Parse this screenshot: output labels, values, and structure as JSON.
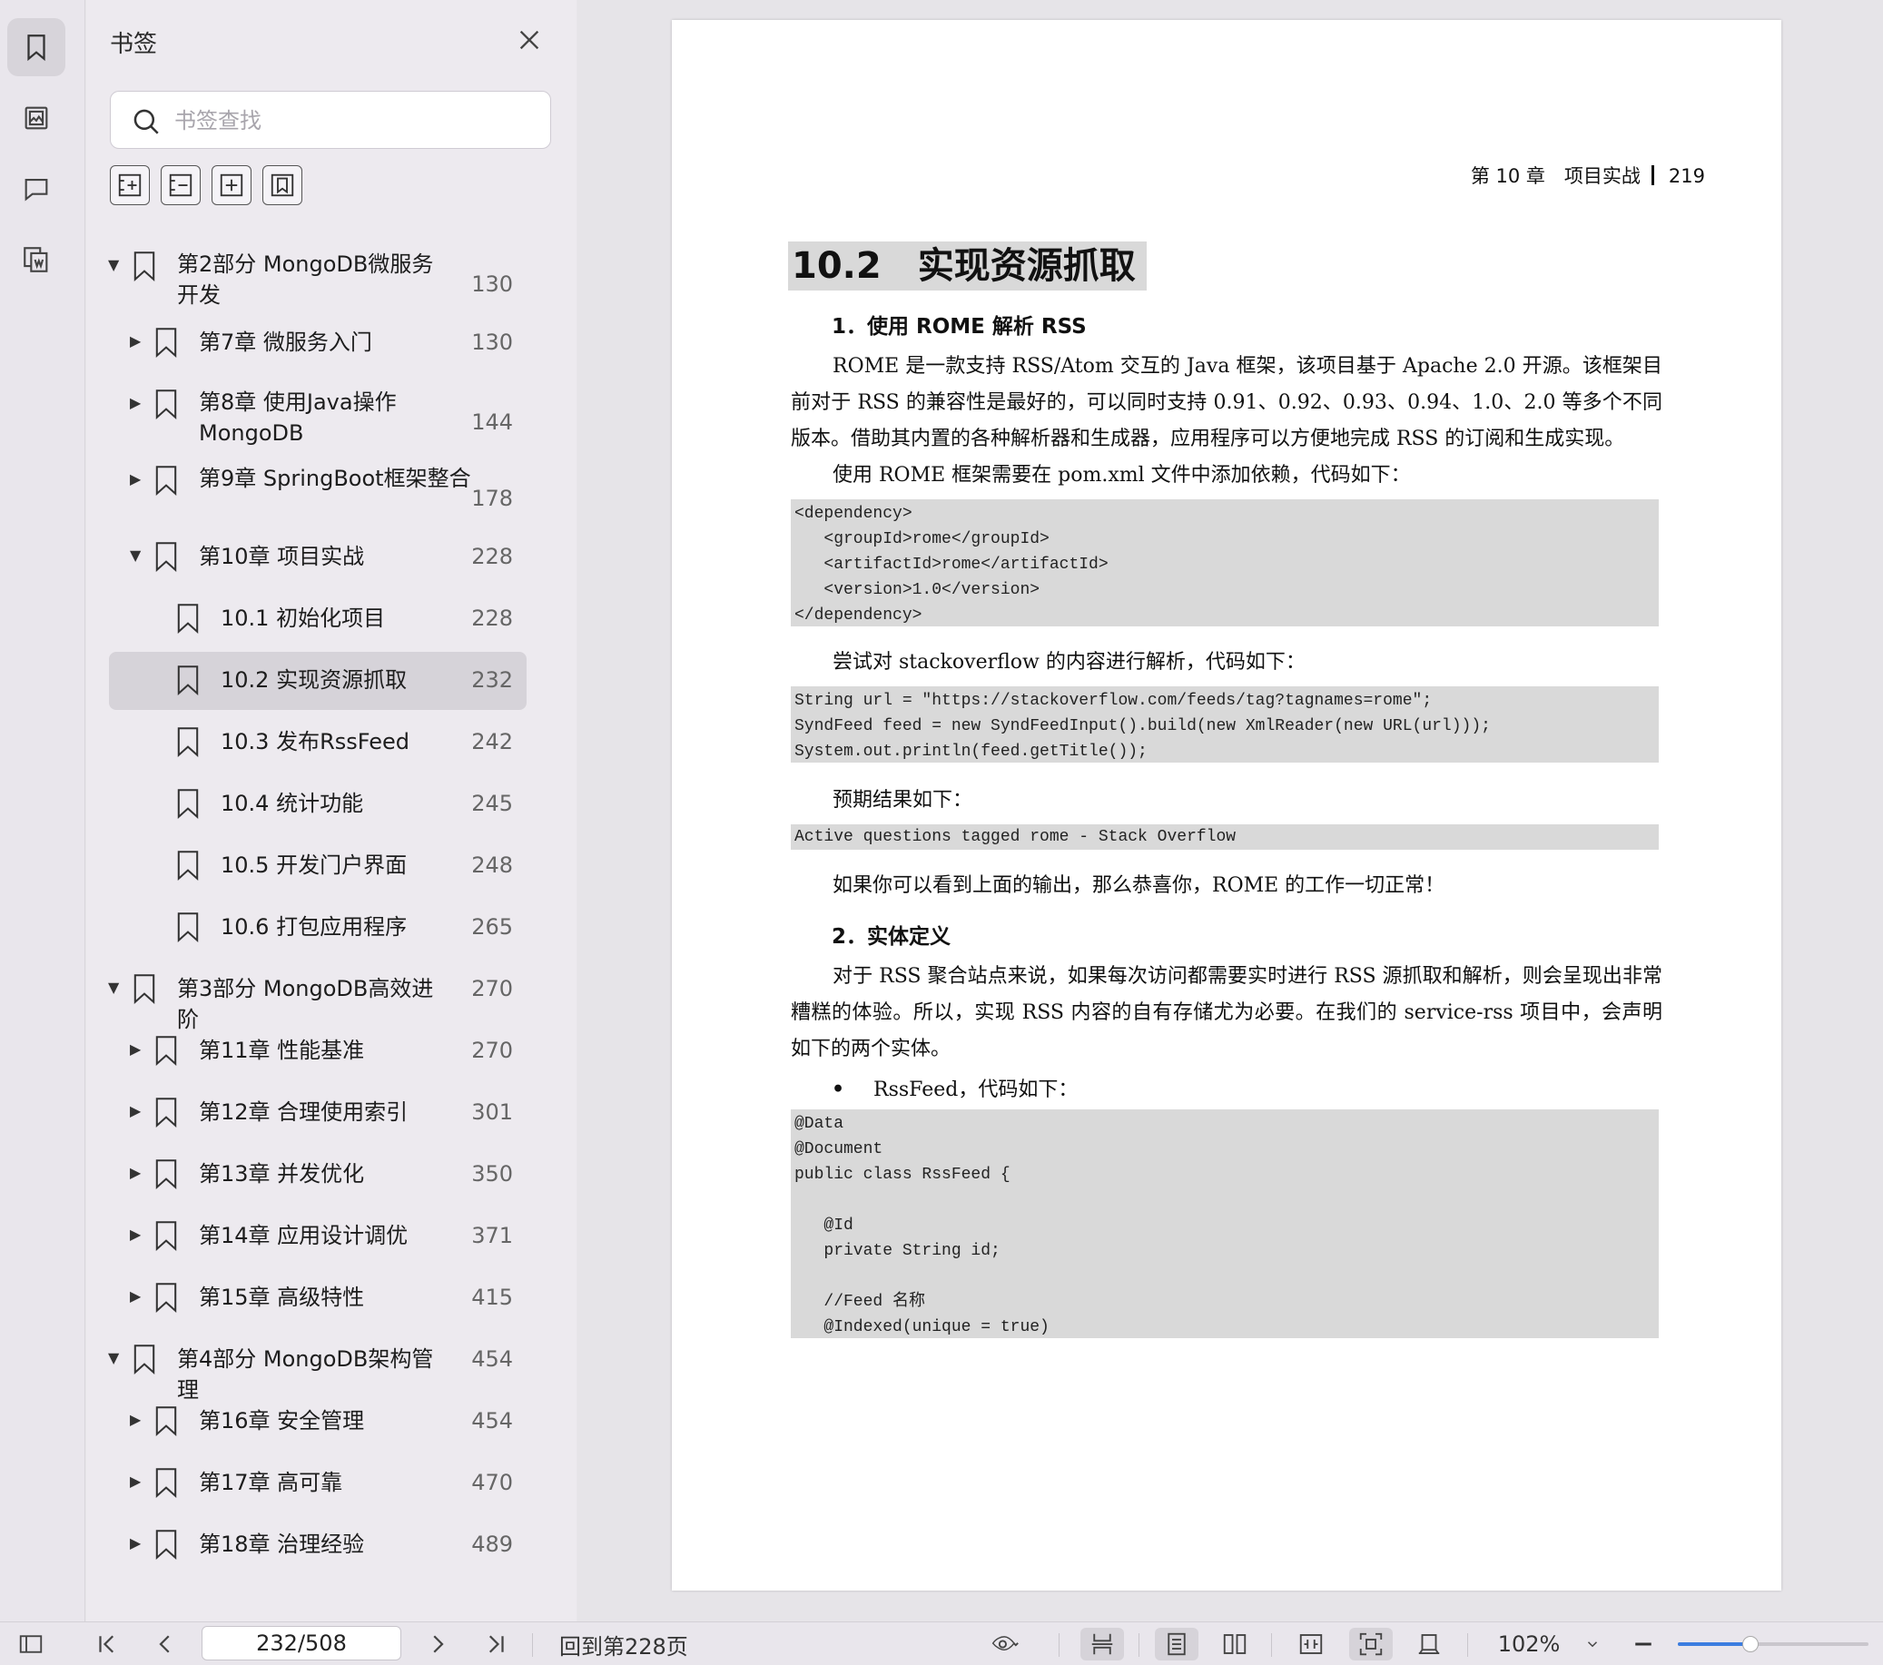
{
  "panel": {
    "title": "书签",
    "search_placeholder": "书签查找"
  },
  "bookmarks": [
    {
      "label": "第2部分 MongoDB微服务开发",
      "page": "130",
      "level": 0,
      "expanded": true
    },
    {
      "label": "第7章 微服务入门",
      "page": "130",
      "level": 1,
      "expanded": false
    },
    {
      "label": "第8章 使用Java操作MongoDB",
      "page": "144",
      "level": 1,
      "expanded": false
    },
    {
      "label": "第9章 SpringBoot框架整合",
      "page": "178",
      "level": 1,
      "expanded": false
    },
    {
      "label": "第10章 项目实战",
      "page": "228",
      "level": 1,
      "expanded": true
    },
    {
      "label": "10.1 初始化项目",
      "page": "228",
      "level": 2
    },
    {
      "label": "10.2 实现资源抓取",
      "page": "232",
      "level": 2,
      "selected": true
    },
    {
      "label": "10.3 发布RssFeed",
      "page": "242",
      "level": 2
    },
    {
      "label": "10.4 统计功能",
      "page": "245",
      "level": 2
    },
    {
      "label": "10.5 开发门户界面",
      "page": "248",
      "level": 2
    },
    {
      "label": "10.6 打包应用程序",
      "page": "265",
      "level": 2
    },
    {
      "label": "第3部分 MongoDB高效进阶",
      "page": "270",
      "level": 0,
      "expanded": true
    },
    {
      "label": "第11章 性能基准",
      "page": "270",
      "level": 1,
      "expanded": false
    },
    {
      "label": "第12章 合理使用索引",
      "page": "301",
      "level": 1,
      "expanded": false
    },
    {
      "label": "第13章 并发优化",
      "page": "350",
      "level": 1,
      "expanded": false
    },
    {
      "label": "第14章 应用设计调优",
      "page": "371",
      "level": 1,
      "expanded": false
    },
    {
      "label": "第15章 高级特性",
      "page": "415",
      "level": 1,
      "expanded": false
    },
    {
      "label": "第4部分 MongoDB架构管理",
      "page": "454",
      "level": 0,
      "expanded": true
    },
    {
      "label": "第16章 安全管理",
      "page": "454",
      "level": 1,
      "expanded": false
    },
    {
      "label": "第17章 高可靠",
      "page": "470",
      "level": 1,
      "expanded": false
    },
    {
      "label": "第18章 治理经验",
      "page": "489",
      "level": 1,
      "expanded": false
    }
  ],
  "document": {
    "running_head_chapter": "第 10 章　项目实战",
    "running_head_page": "219",
    "section_title": "10.2　实现资源抓取",
    "sub1": "1．使用 ROME 解析 RSS",
    "para1": "ROME 是一款支持 RSS/Atom 交互的 Java 框架，该项目基于 Apache 2.0 开源。该框架目前对于 RSS 的兼容性是最好的，可以同时支持 0.91、0.92、0.93、0.94、1.0、2.0 等多个不同版本。借助其内置的各种解析器和生成器，应用程序可以方便地完成 RSS 的订阅和生成实现。",
    "para2": "使用 ROME 框架需要在 pom.xml 文件中添加依赖，代码如下：",
    "code1": "<dependency>\n   <groupId>rome</groupId>\n   <artifactId>rome</artifactId>\n   <version>1.0</version>\n</dependency>",
    "para3": "尝试对 stackoverflow 的内容进行解析，代码如下：",
    "code2": "String url = \"https://stackoverflow.com/feeds/tag?tagnames=rome\";\nSyndFeed feed = new SyndFeedInput().build(new XmlReader(new URL(url)));\nSystem.out.println(feed.getTitle());",
    "para4": "预期结果如下：",
    "code3": "Active questions tagged rome - Stack Overflow",
    "para5": "如果你可以看到上面的输出，那么恭喜你，ROME 的工作一切正常！",
    "sub2": "2．实体定义",
    "para6": "对于 RSS 聚合站点来说，如果每次访问都需要实时进行 RSS 源抓取和解析，则会呈现出非常糟糕的体验。所以，实现 RSS 内容的自有存储尤为必要。在我们的 service-rss 项目中，会声明如下的两个实体。",
    "bullet1": "RssFeed，代码如下：",
    "code4": "@Data\n@Document\npublic class RssFeed {\n\n   @Id\n   private String id;\n\n   //Feed 名称\n   @Indexed(unique = true)"
  },
  "toolbar": {
    "page_indicator": "232/508",
    "goto_label": "回到第228页",
    "zoom": "102%",
    "zoom_slider_fraction": 0.38
  }
}
